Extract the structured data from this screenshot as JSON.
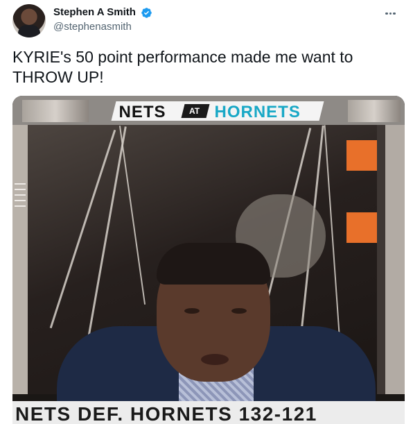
{
  "tweet": {
    "author": {
      "display_name": "Stephen A Smith",
      "handle": "@stephenasmith",
      "verified": true,
      "avatar": "profile-photo"
    },
    "text": "KYRIE's 50 point performance made me want to\nTHROW UP!",
    "more_icon": "ellipsis-icon",
    "media": {
      "type": "video-still",
      "graphic_top": {
        "team1": "NETS",
        "at": "AT",
        "team2": "HORNETS"
      },
      "lower_third": "NETS DEF. HORNETS 132-121"
    },
    "colors": {
      "verified_blue": "#1d9bf0",
      "hornets_teal": "#19a8c6",
      "accent_orange": "#e8702a",
      "suit_navy": "#1e2a45"
    }
  }
}
